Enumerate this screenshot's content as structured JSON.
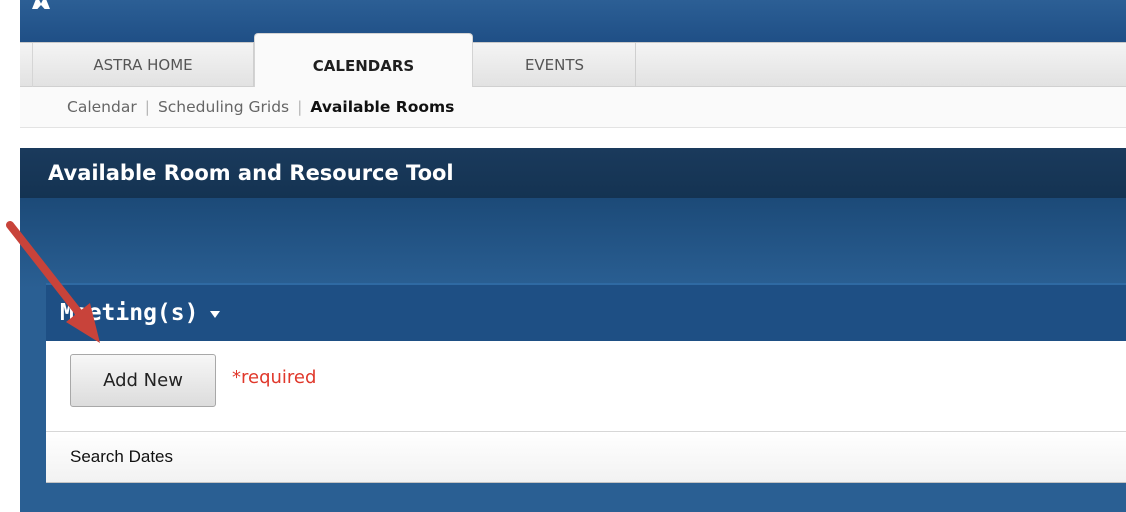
{
  "nav": {
    "tabs": [
      {
        "label": "ASTRA HOME"
      },
      {
        "label": "CALENDARS"
      },
      {
        "label": "EVENTS"
      }
    ]
  },
  "subnav": {
    "items": [
      {
        "label": "Calendar"
      },
      {
        "label": "Scheduling Grids"
      },
      {
        "label": "Available Rooms"
      }
    ],
    "separator": "|"
  },
  "page": {
    "title": "Available Room and Resource Tool"
  },
  "meetings": {
    "heading": "Meeting(s)",
    "add_button": "Add New",
    "required_note": "*required",
    "search_dates_label": "Search Dates"
  },
  "annotation": {
    "arrow_color": "#c8433a"
  }
}
